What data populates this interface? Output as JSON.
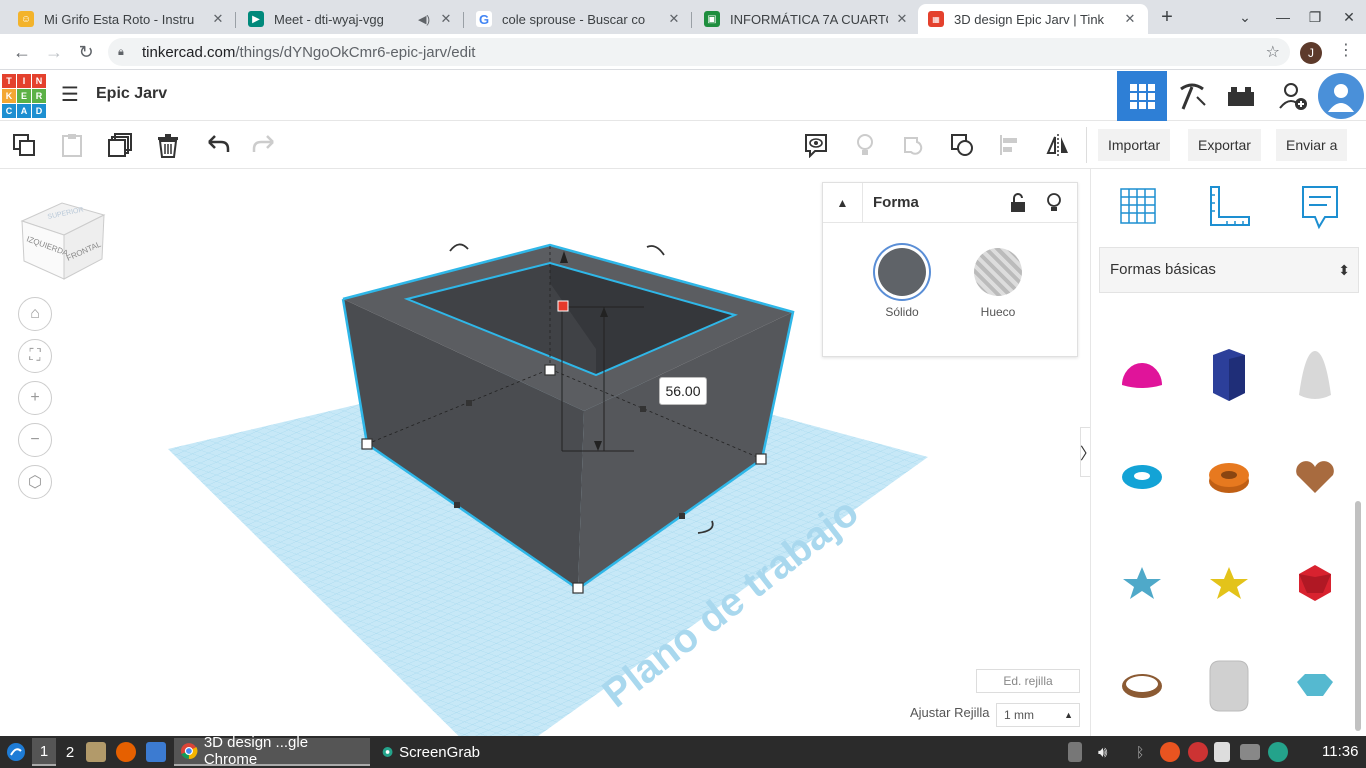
{
  "browser": {
    "tabs": [
      {
        "title": "Mi Grifo Esta Roto - Instru",
        "active": false
      },
      {
        "title": "Meet - dti-wyaj-vgg",
        "active": false
      },
      {
        "title": "cole sprouse - Buscar co",
        "active": false
      },
      {
        "title": "INFORMÁTICA 7A CUARTO",
        "active": false
      },
      {
        "title": "3D design Epic Jarv | Tink",
        "active": true
      }
    ],
    "url_host": "tinkercad.com",
    "url_path": "/things/dYNgoOkCmr6-epic-jarv/edit",
    "profile_initial": "J"
  },
  "header": {
    "logo_letters": [
      "T",
      "I",
      "N",
      "K",
      "E",
      "R",
      "C",
      "A",
      "D"
    ],
    "design_title": "Epic Jarv"
  },
  "edit_toolbar": {
    "import_label": "Importar",
    "export_label": "Exportar",
    "send_label": "Enviar a"
  },
  "viewcube": {
    "left_face": "IZQUIERDA",
    "front_face": "FRONTAL",
    "top_face": "SUPERIOR"
  },
  "shape_panel": {
    "title": "Forma",
    "solid_label": "Sólido",
    "hole_label": "Hueco",
    "solid_color": "#5f6368"
  },
  "canvas": {
    "dimension_value": "56.00",
    "workplane_label": "Plano de trabajo",
    "edit_grid_label": "Ed. rejilla",
    "snap_grid_label": "Ajustar Rejilla",
    "snap_grid_value": "1 mm"
  },
  "sidebar": {
    "category_label": "Formas básicas",
    "shapes": [
      {
        "name": "half-sphere",
        "color": "#e0149a"
      },
      {
        "name": "hexagonal-prism",
        "color": "#2c3f9a"
      },
      {
        "name": "paraboloid",
        "color": "#d8d8d8"
      },
      {
        "name": "torus",
        "color": "#13a3d6"
      },
      {
        "name": "tube",
        "color": "#e7791f"
      },
      {
        "name": "heart",
        "color": "#a86b3f"
      },
      {
        "name": "star",
        "color": "#4fa9c9"
      },
      {
        "name": "star-yellow",
        "color": "#e3c31a"
      },
      {
        "name": "icosahedron",
        "color": "#d8222f"
      },
      {
        "name": "ring",
        "color": "#8b5a33"
      },
      {
        "name": "rounded-box",
        "color": "#d0d0d0"
      },
      {
        "name": "gem",
        "color": "#55b9d0"
      }
    ]
  },
  "taskbar": {
    "workspace_1": "1",
    "workspace_2": "2",
    "chrome_window": "3D design ...gle Chrome",
    "screengrab_window": "ScreenGrab",
    "clock": "11:36"
  }
}
